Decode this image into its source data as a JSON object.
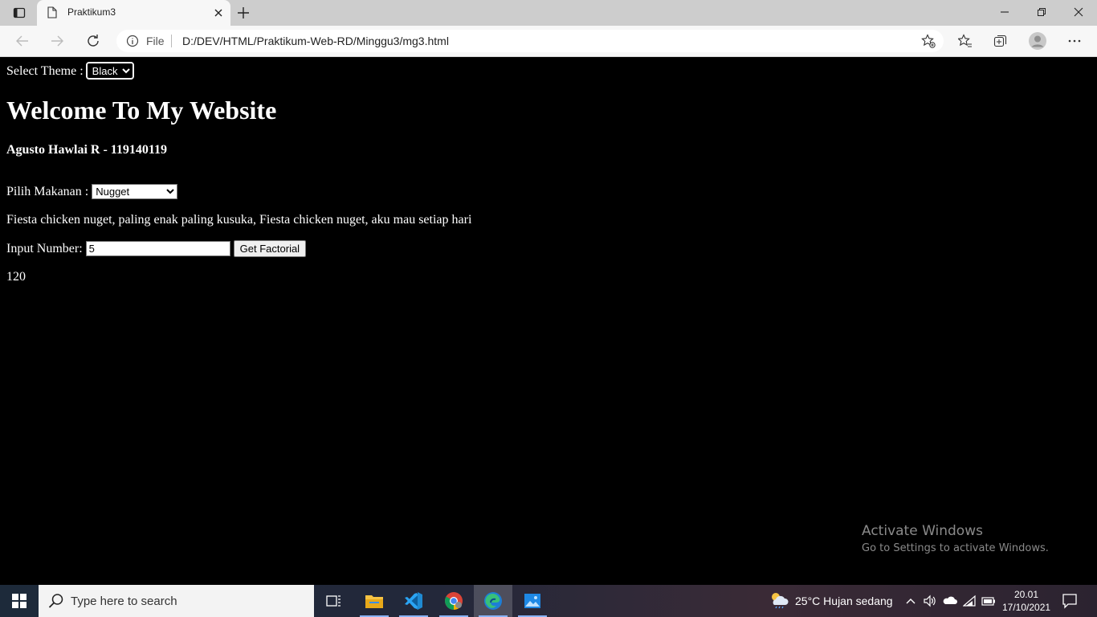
{
  "browser": {
    "tab_title": "Praktikum3",
    "file_label": "File",
    "url": "D:/DEV/HTML/Praktikum-Web-RD/Minggu3/mg3.html"
  },
  "page": {
    "theme_label": "Select Theme :",
    "theme_selected": "Black",
    "heading": "Welcome To My Website",
    "subheading": "Agusto Hawlai R - 119140119",
    "food_label": "Pilih Makanan :",
    "food_selected": "Nugget",
    "food_description": "Fiesta chicken nuget, paling enak paling kusuka, Fiesta chicken nuget, aku mau setiap hari",
    "number_label": "Input Number:",
    "number_value": "5",
    "factorial_button": "Get Factorial",
    "result": "120"
  },
  "watermark": {
    "line1": "Activate Windows",
    "line2": "Go to Settings to activate Windows."
  },
  "taskbar": {
    "search_placeholder": "Type here to search",
    "weather": "25°C  Hujan sedang",
    "time": "20.01",
    "date": "17/10/2021"
  }
}
